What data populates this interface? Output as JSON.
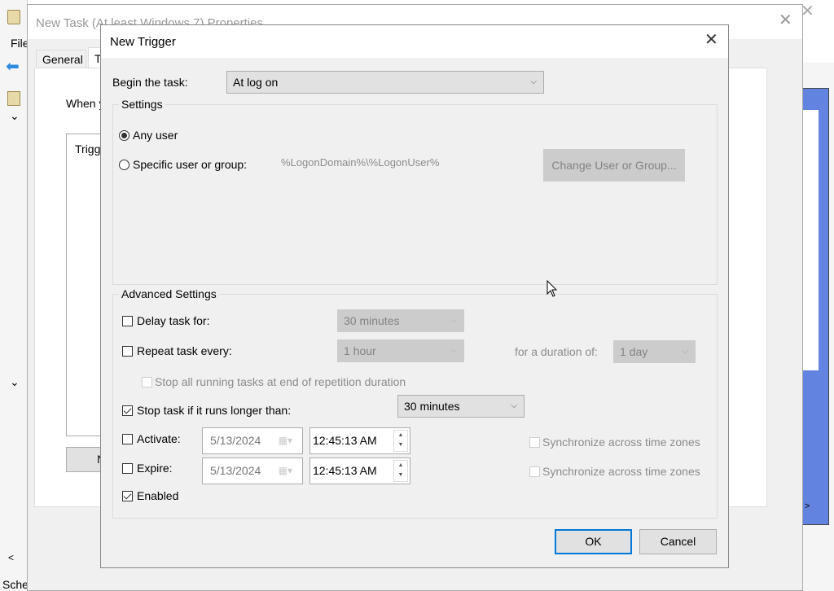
{
  "background_app": {
    "menu_file": "File",
    "status_text": "Sche",
    "scroll_left": "<",
    "scroll_right": ">",
    "chevron": "⌄",
    "accent_color": "#6283df"
  },
  "properties_dialog": {
    "title": "New Task (At least Windows 7) Properties",
    "tabs": [
      {
        "label": "General"
      },
      {
        "label": "T"
      }
    ],
    "intro_text": "When y",
    "triggers_header": "Trigg",
    "new_button": "Ne"
  },
  "trigger_dialog": {
    "title": "New Trigger",
    "begin_label": "Begin the task:",
    "begin_value": "At log on",
    "settings": {
      "label": "Settings",
      "any_user": "Any user",
      "any_user_selected": true,
      "specific_user": "Specific user or group:",
      "specific_user_value": "%LogonDomain%\\%LogonUser%",
      "change_button": "Change User or Group..."
    },
    "advanced": {
      "label": "Advanced Settings",
      "delay_label": "Delay task for:",
      "delay_checked": false,
      "delay_value": "30 minutes",
      "repeat_label": "Repeat task every:",
      "repeat_checked": false,
      "repeat_value": "1 hour",
      "duration_label": "for a duration of:",
      "duration_value": "1 day",
      "stop_all_label": "Stop all running tasks at end of repetition duration",
      "stop_label": "Stop task if it runs longer than:",
      "stop_checked": true,
      "stop_value": "30 minutes",
      "activate_label": "Activate:",
      "activate_checked": false,
      "activate_date": "5/13/2024",
      "activate_time": "12:45:13 AM",
      "expire_label": "Expire:",
      "expire_checked": false,
      "expire_date": "5/13/2024",
      "expire_time": "12:45:13 AM",
      "sync_label": "Synchronize across time zones",
      "enabled_label": "Enabled",
      "enabled_checked": true
    },
    "ok_button": "OK",
    "cancel_button": "Cancel",
    "ok_border_color": "#0078d7"
  }
}
